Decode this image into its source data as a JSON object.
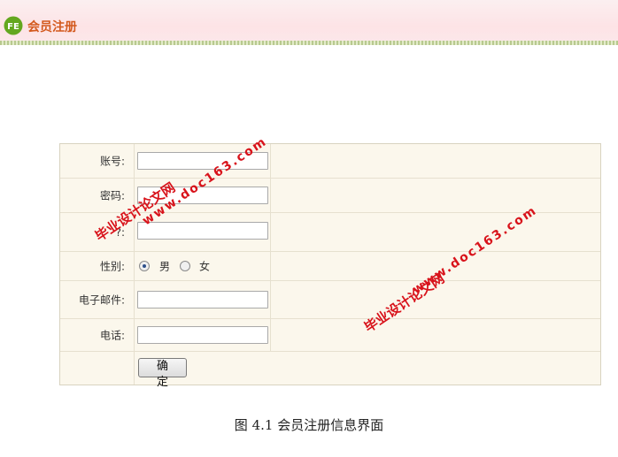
{
  "header": {
    "title": "会员注册",
    "logo_icon": "fe-logo-icon",
    "logo_text": "FE"
  },
  "form": {
    "account_label": "账号:",
    "password_label": "密码:",
    "confirm_label": "?:",
    "gender_label": "性别:",
    "gender_options": [
      "男",
      "女"
    ],
    "gender_selected": "男",
    "email_label": "电子邮件:",
    "phone_label": "电话:",
    "submit_label": "确 定",
    "account_value": "",
    "password_value": "",
    "confirm_value": "",
    "email_value": "",
    "phone_value": ""
  },
  "watermarks": {
    "site_name": "毕业设计论文网",
    "url": "www.doc163.com"
  },
  "caption": "图 4.1  会员注册信息界面",
  "colors": {
    "header_title": "#d3591d",
    "logo_green": "#63a71f",
    "watermark": "#d8131b",
    "form_background": "#fbf7ec"
  }
}
